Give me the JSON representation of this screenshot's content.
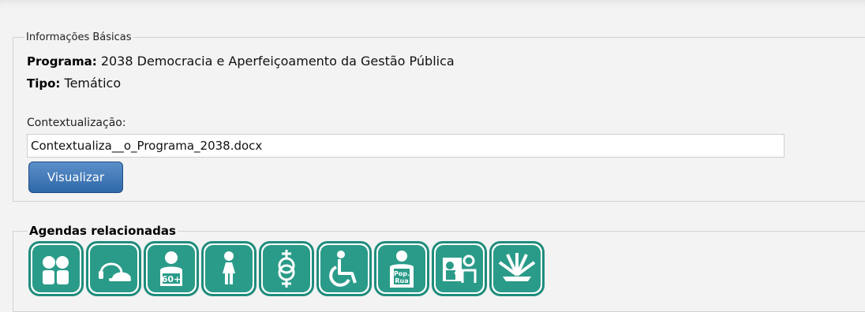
{
  "basic_info": {
    "legend": "Informações Básicas",
    "programa_label": "Programa:",
    "programa_value": "2038 Democracia e Aperfeiçoamento da Gestão Pública",
    "tipo_label": "Tipo:",
    "tipo_value": "Temático",
    "contextualizacao_label": "Contextualização:",
    "contextualizacao_file": "Contextualiza__o_Programa_2038.docx",
    "visualizar_label": "Visualizar"
  },
  "agendas": {
    "legend": "Agendas relacionadas",
    "icons": [
      {
        "name": "children-icon"
      },
      {
        "name": "youth-icon"
      },
      {
        "name": "elderly-icon",
        "text": "60+"
      },
      {
        "name": "woman-icon"
      },
      {
        "name": "lgbt-icon"
      },
      {
        "name": "wheelchair-icon"
      },
      {
        "name": "street-population-icon",
        "text": "Pop. Rua"
      },
      {
        "name": "education-icon"
      },
      {
        "name": "indigenous-icon"
      }
    ]
  },
  "colors": {
    "icon_green": "#2a9b89",
    "icon_border": "#1f8c7c",
    "button_blue": "#2f68a8"
  }
}
